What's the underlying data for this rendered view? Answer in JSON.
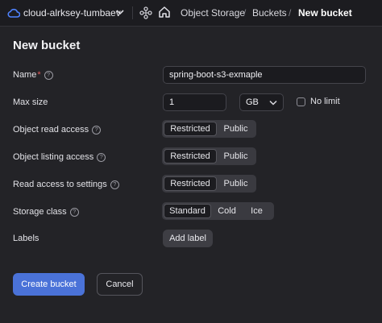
{
  "header": {
    "cloud_name": "cloud-alrksey-tumbaev",
    "breadcrumbs": [
      "Object Storage",
      "Buckets",
      "New bucket"
    ]
  },
  "page": {
    "title": "New bucket"
  },
  "form": {
    "name": {
      "label": "Name",
      "required_mark": "*",
      "value": "spring-boot-s3-exmaple"
    },
    "max_size": {
      "label": "Max size",
      "value": "1",
      "unit": "GB",
      "no_limit_label": "No limit",
      "no_limit_checked": false
    },
    "object_read_access": {
      "label": "Object read access",
      "options": [
        "Restricted",
        "Public"
      ],
      "selected": "Restricted"
    },
    "object_listing_access": {
      "label": "Object listing access",
      "options": [
        "Restricted",
        "Public"
      ],
      "selected": "Restricted"
    },
    "read_access_settings": {
      "label": "Read access to settings",
      "options": [
        "Restricted",
        "Public"
      ],
      "selected": "Restricted"
    },
    "storage_class": {
      "label": "Storage class",
      "options": [
        "Standard",
        "Cold",
        "Ice"
      ],
      "selected": "Standard"
    },
    "labels": {
      "label": "Labels",
      "add_label": "Add label"
    }
  },
  "actions": {
    "create": "Create bucket",
    "cancel": "Cancel"
  },
  "colors": {
    "accent": "#4a72d8",
    "background": "#232327",
    "required": "#e25a5a"
  },
  "icons": [
    "cloud-icon",
    "chevron-down-icon",
    "network-icon",
    "home-icon",
    "help-icon"
  ]
}
